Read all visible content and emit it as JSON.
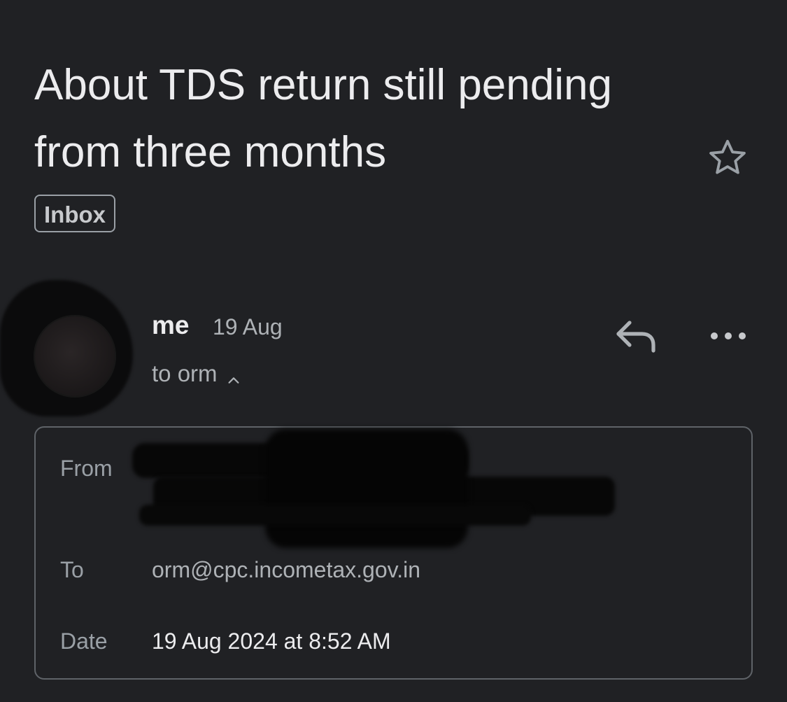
{
  "email": {
    "subject": "About TDS return still pending from three months",
    "label": "Inbox",
    "sender": "me",
    "date_short": "19 Aug",
    "recipients_summary": "to orm",
    "details": {
      "from_label": "From",
      "to_label": "To",
      "to_value": "orm@cpc.incometax.gov.in",
      "date_label": "Date",
      "date_value": "19 Aug 2024 at 8:52 AM"
    }
  },
  "icons": {
    "star": "star-outline-icon",
    "reply": "reply-icon",
    "more": "more-horizontal-icon",
    "expand": "chevron-up-icon"
  },
  "colors": {
    "background": "#202124",
    "text_primary": "#ececee",
    "text_secondary": "#aeb2b6",
    "border": "#5f6368"
  }
}
